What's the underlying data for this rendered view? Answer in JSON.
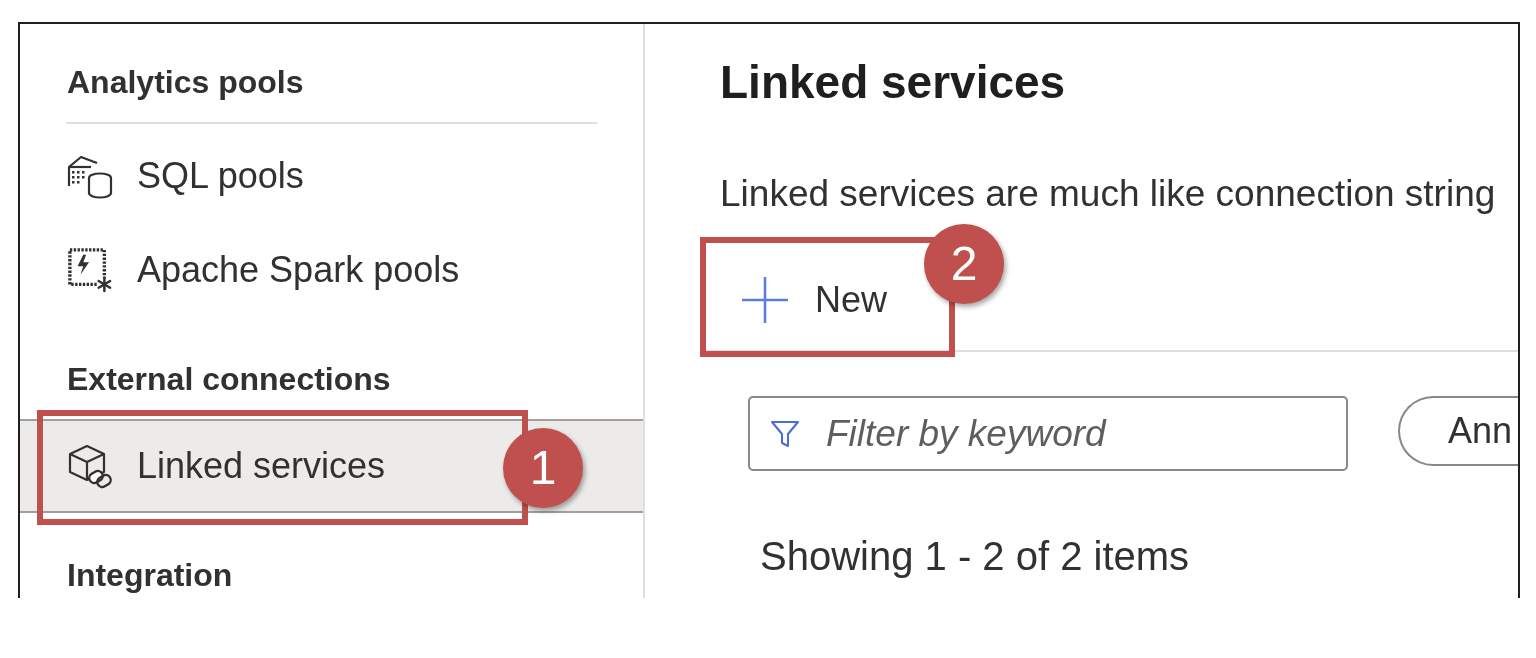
{
  "sidebar": {
    "sections": [
      {
        "title": "Analytics pools",
        "divider": true,
        "items": [
          {
            "label": "SQL pools",
            "selected": false
          },
          {
            "label": "Apache Spark pools",
            "selected": false
          }
        ]
      },
      {
        "title": "External connections",
        "divider": false,
        "items": [
          {
            "label": "Linked services",
            "selected": true,
            "callout": "1"
          }
        ]
      },
      {
        "title": "Integration",
        "divider": false
      }
    ]
  },
  "main": {
    "title": "Linked services",
    "description": "Linked services are much like connection string",
    "toolbar": [
      {
        "label": "New",
        "callout": "2"
      }
    ],
    "filter": {
      "placeholder": "Filter by keyword"
    },
    "filter_pill": {
      "label": "Ann"
    },
    "item_count": "Showing 1 - 2 of 2 items"
  }
}
